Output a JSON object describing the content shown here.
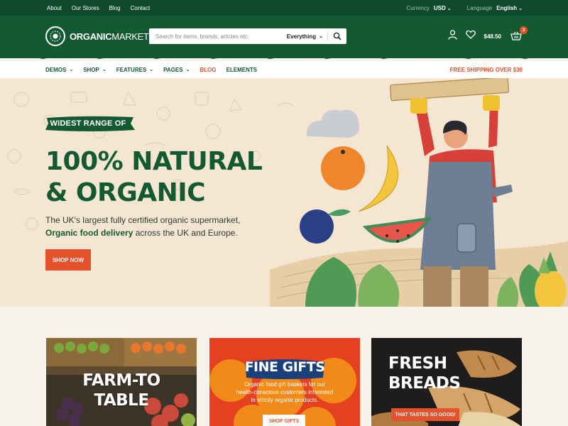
{
  "topbar": {
    "links": [
      "About",
      "Our Stores",
      "Blog",
      "Contact"
    ],
    "currency_label": "Currency",
    "currency_value": "USD",
    "language_label": "Language",
    "language_value": "English"
  },
  "header": {
    "logo_bold": "ORGANIC",
    "logo_thin": "MARKET",
    "search_placeholder": "Search for items, brands, articles etc.",
    "search_scope": "Everything",
    "cart_total": "$48.50",
    "cart_count": "3"
  },
  "nav": {
    "items": [
      {
        "label": "Demos",
        "dropdown": true
      },
      {
        "label": "Shop",
        "dropdown": true
      },
      {
        "label": "Features",
        "dropdown": true
      },
      {
        "label": "Pages",
        "dropdown": true
      },
      {
        "label": "Blog",
        "dropdown": false,
        "active": true
      },
      {
        "label": "Elements",
        "dropdown": false
      }
    ],
    "promo": "FREE SHIPPING OVER $30"
  },
  "hero": {
    "tag": "WIDEST RANGE OF",
    "title_line1": "100% NATURAL",
    "title_line2": "& ORGANIC",
    "desc_line1": "The UK's largest fully certified organic supermarket,",
    "desc_bold": "Organic food delivery",
    "desc_rest": " across the UK and Europe.",
    "cta": "SHOP NOW"
  },
  "cards": {
    "farm": {
      "title_line1": "FARM-TO",
      "title_line2": "TABLE"
    },
    "gifts": {
      "title": "FINE GIFTS",
      "sub_line1": "Organic food gift baskets for our",
      "sub_line2": "health-conscious customers interested",
      "sub_line3": "in strictly organic products.",
      "button": "SHOP GIFTS"
    },
    "breads": {
      "title_line1": "FRESH",
      "title_line2": "BREADS",
      "tag": "THAT TASTES SO GOOD!"
    }
  },
  "colors": {
    "brand_green": "#135a33",
    "dark_green": "#0f4a2c",
    "accent_orange": "#e4512a",
    "hero_bg": "#f4e6d0"
  },
  "icons": [
    "logo-icon",
    "search-icon",
    "user-icon",
    "heart-icon",
    "cart-icon",
    "chevron-down-icon"
  ]
}
